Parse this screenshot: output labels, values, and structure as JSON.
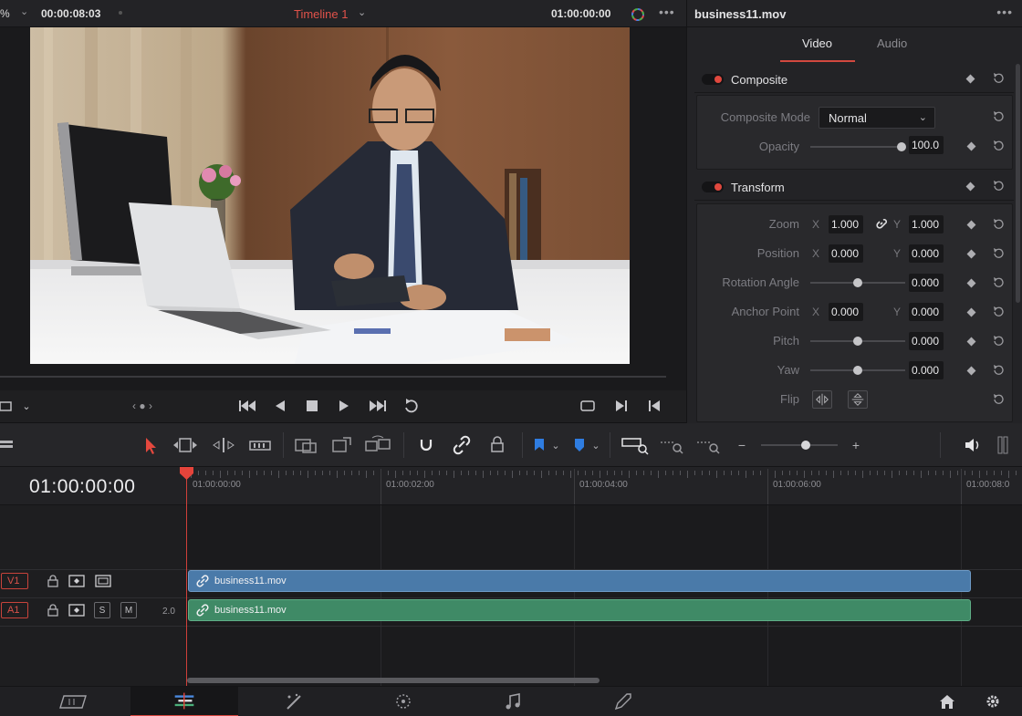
{
  "viewer": {
    "zoom": "%",
    "timecode_left": "00:00:08:03",
    "timeline_name": "Timeline 1",
    "timecode_right": "01:00:00:00"
  },
  "inspector": {
    "clip_name": "business11.mov",
    "tabs": [
      {
        "label": "Video",
        "active": true
      },
      {
        "label": "Audio",
        "active": false
      }
    ],
    "composite": {
      "title": "Composite",
      "mode_label": "Composite Mode",
      "mode_value": "Normal",
      "opacity_label": "Opacity",
      "opacity_value": "100.0",
      "opacity_fraction": 1.0
    },
    "transform": {
      "title": "Transform",
      "zoom_label": "Zoom",
      "zoom_x": "1.000",
      "zoom_y": "1.000",
      "position_label": "Position",
      "position_x": "0.000",
      "position_y": "0.000",
      "rotation_label": "Rotation Angle",
      "rotation_value": "0.000",
      "anchor_label": "Anchor Point",
      "anchor_x": "0.000",
      "anchor_y": "0.000",
      "pitch_label": "Pitch",
      "pitch_value": "0.000",
      "yaw_label": "Yaw",
      "yaw_value": "0.000",
      "flip_label": "Flip",
      "axis_x": "X",
      "axis_y": "Y"
    }
  },
  "timeline": {
    "current_timecode": "01:00:00:00",
    "ruler_labels": [
      "01:00:00:00",
      "01:00:02:00",
      "01:00:04:00",
      "01:00:06:00",
      "01:00:08:0"
    ],
    "tracks": [
      {
        "name": "V1",
        "clip": "business11.mov",
        "type": "video"
      },
      {
        "name": "A1",
        "clip": "business11.mov",
        "type": "audio",
        "channels": "2.0",
        "solo": "S",
        "mute": "M"
      }
    ]
  },
  "pages": [
    "media",
    "edit",
    "fusion",
    "color",
    "fairlight",
    "deliver"
  ],
  "colors": {
    "accent": "#d6453d",
    "video_clip": "#4a7aa9",
    "audio_clip": "#3f8a66",
    "flag_blue": "#2f7de1"
  }
}
